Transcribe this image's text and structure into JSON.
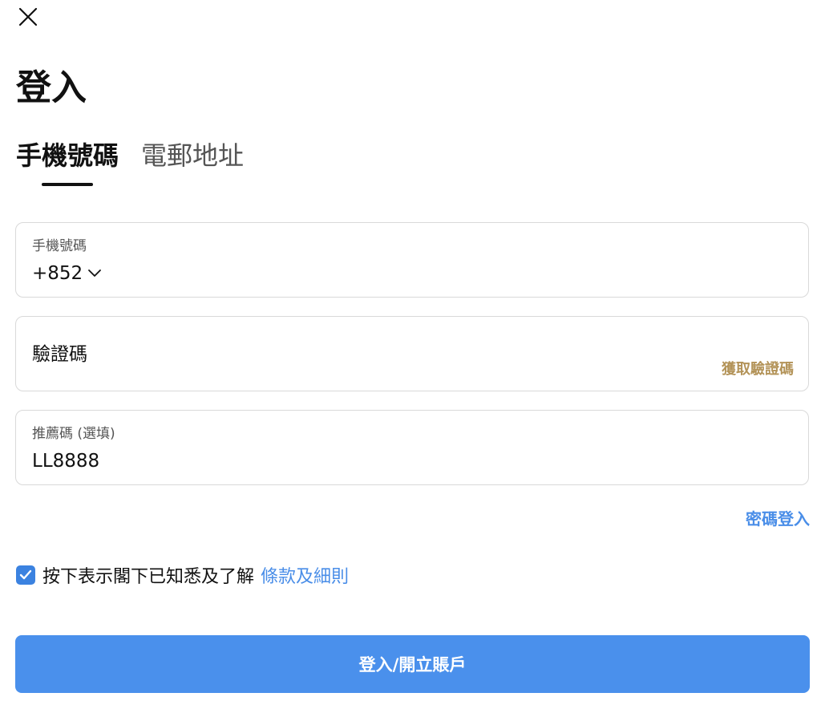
{
  "header": {
    "close_icon": "close-icon",
    "title": "登入"
  },
  "tabs": [
    {
      "label": "手機號碼",
      "active": true
    },
    {
      "label": "電郵地址",
      "active": false
    }
  ],
  "phone_field": {
    "label": "手機號碼",
    "country_code": "+852",
    "dropdown_icon": "chevron-down-icon"
  },
  "otp_field": {
    "label": "驗證碼",
    "get_code_label": "獲取驗證碼"
  },
  "referral_field": {
    "label": "推薦碼 (選填)",
    "value": "LL8888"
  },
  "password_login_label": "密碼登入",
  "agreement": {
    "checked": true,
    "text": "按下表示閣下已知悉及了解",
    "terms_label": "條款及細則"
  },
  "submit_label": "登入/開立賬戶",
  "colors": {
    "accent_blue": "#4a90ec",
    "link_blue": "#4a8ee8",
    "gold": "#b39358",
    "checkbox_blue": "#3b82e0"
  }
}
